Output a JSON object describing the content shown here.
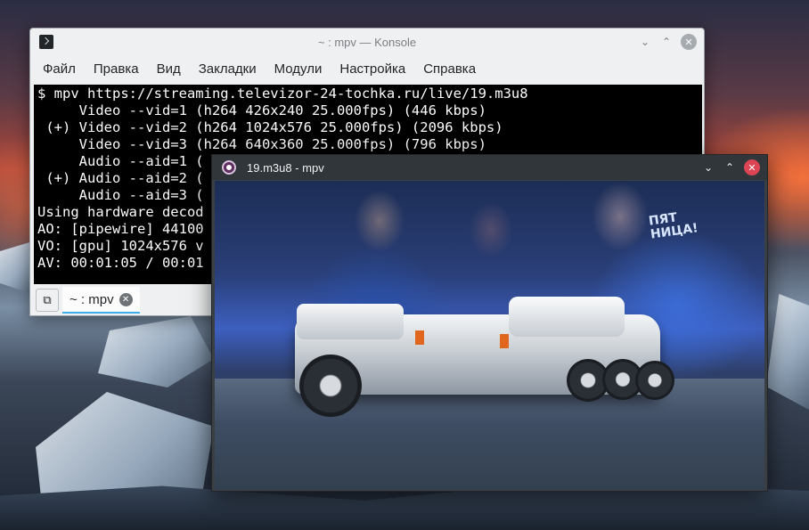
{
  "konsole": {
    "title": "~ : mpv — Konsole",
    "menu": [
      "Файл",
      "Правка",
      "Вид",
      "Закладки",
      "Модули",
      "Настройка",
      "Справка"
    ],
    "terminal_lines": [
      "$ mpv https://streaming.televizor-24-tochka.ru/live/19.m3u8",
      "     Video --vid=1 (h264 426x240 25.000fps) (446 kbps)",
      " (+) Video --vid=2 (h264 1024x576 25.000fps) (2096 kbps)",
      "     Video --vid=3 (h264 640x360 25.000fps) (796 kbps)",
      "     Audio --aid=1 (",
      " (+) Audio --aid=2 (",
      "     Audio --aid=3 (",
      "Using hardware decod",
      "AO: [pipewire] 44100",
      "VO: [gpu] 1024x576 v",
      "AV: 00:01:05 / 00:01"
    ],
    "tab_label": "~ : mpv"
  },
  "mpv": {
    "title": "19.m3u8 - mpv",
    "video_sign_text": "ПЯТ\nНИЦА!"
  },
  "colors": {
    "konsole_bg": "#eff0f1",
    "terminal_bg": "#000000",
    "terminal_fg": "#fcfcfc",
    "tab_accent": "#3daee9",
    "mpv_titlebar": "#31363b",
    "mpv_close": "#da4453"
  }
}
